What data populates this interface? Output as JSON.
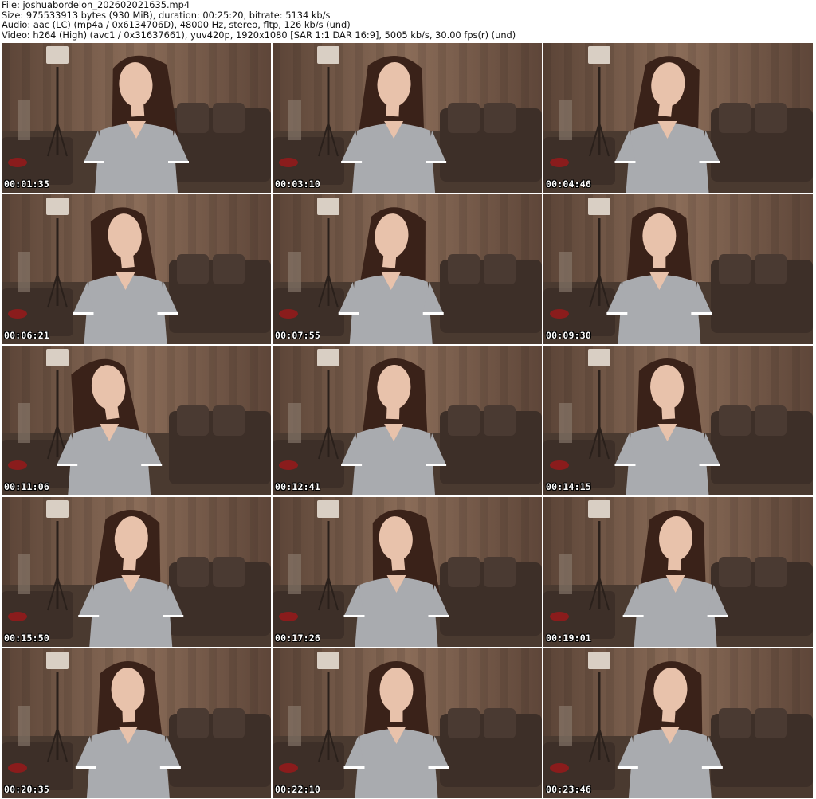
{
  "header": {
    "file": "File: joshuabordelon_202602021635.mp4",
    "size": "Size: 975533913 bytes (930 MiB), duration: 00:25:20, bitrate: 5134 kb/s",
    "audio": "Audio: aac (LC) (mp4a / 0x6134706D), 48000 Hz, stereo, fltp, 126 kb/s (und)",
    "video": "Video: h264 (High) (avc1 / 0x31637661), yuv420p, 1920x1080 [SAR 1:1 DAR 16:9], 5005 kb/s, 30.00 fps(r) (und)"
  },
  "thumbnails": [
    {
      "time": "00:01:35",
      "pose": {
        "headX": 0.5,
        "tilt": -4,
        "hairShift": 0.02
      }
    },
    {
      "time": "00:03:10",
      "pose": {
        "headX": 0.45,
        "tilt": 3,
        "hairShift": 0
      }
    },
    {
      "time": "00:04:46",
      "pose": {
        "headX": 0.46,
        "tilt": 6,
        "hairShift": 0.01
      }
    },
    {
      "time": "00:06:21",
      "pose": {
        "headX": 0.46,
        "tilt": -6,
        "hairShift": -0.02
      }
    },
    {
      "time": "00:07:55",
      "pose": {
        "headX": 0.44,
        "tilt": 5,
        "hairShift": 0.02
      }
    },
    {
      "time": "00:09:30",
      "pose": {
        "headX": 0.43,
        "tilt": 0,
        "hairShift": 0
      }
    },
    {
      "time": "00:11:06",
      "pose": {
        "headX": 0.4,
        "tilt": -8,
        "hairShift": -0.03
      }
    },
    {
      "time": "00:12:41",
      "pose": {
        "headX": 0.45,
        "tilt": 2,
        "hairShift": 0.01
      }
    },
    {
      "time": "00:14:15",
      "pose": {
        "headX": 0.46,
        "tilt": -3,
        "hairShift": 0
      }
    },
    {
      "time": "00:15:50",
      "pose": {
        "headX": 0.48,
        "tilt": 4,
        "hairShift": 0
      }
    },
    {
      "time": "00:17:26",
      "pose": {
        "headX": 0.46,
        "tilt": -5,
        "hairShift": 0.02
      }
    },
    {
      "time": "00:19:01",
      "pose": {
        "headX": 0.49,
        "tilt": 3,
        "hairShift": 0
      }
    },
    {
      "time": "00:20:35",
      "pose": {
        "headX": 0.47,
        "tilt": -2,
        "hairShift": 0
      }
    },
    {
      "time": "00:22:10",
      "pose": {
        "headX": 0.46,
        "tilt": 0,
        "hairShift": 0
      }
    },
    {
      "time": "00:23:46",
      "pose": {
        "headX": 0.47,
        "tilt": 4,
        "hairShift": 0.01
      }
    }
  ],
  "colors": {
    "wall": "#6f5444",
    "curtain": "#8a6c58",
    "sofa": "#3d2f28",
    "floor": "#4a3a30",
    "shirt": "#a9abaf",
    "hair": "#3a2219",
    "skin": "#e8c2ab",
    "lamp": "#d9cfc4"
  }
}
